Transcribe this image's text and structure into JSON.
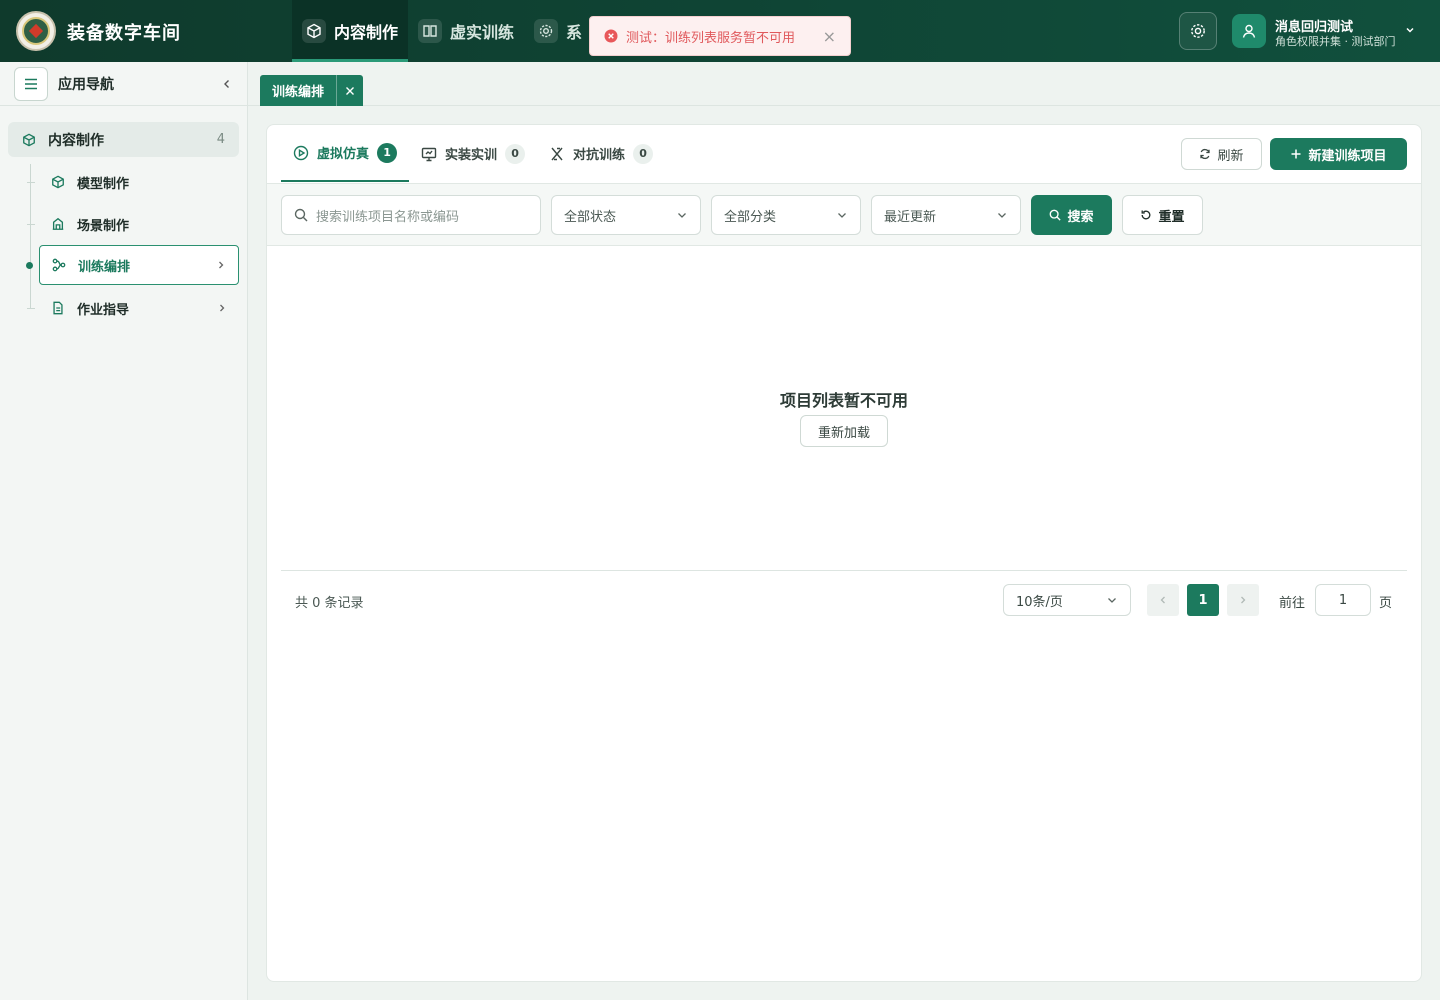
{
  "header": {
    "app_title": "装备数字车间",
    "nav": [
      {
        "label": "内容制作",
        "active": true,
        "icon": "cube-icon"
      },
      {
        "label": "虚实训练",
        "active": false,
        "icon": "book-icon"
      },
      {
        "label": "系",
        "active": false,
        "icon": "gear-icon"
      }
    ],
    "user": {
      "name": "消息回归测试",
      "role": "角色权限并集 · 测试部门"
    }
  },
  "toast": {
    "message": "测试：训练列表服务暂不可用",
    "type": "error"
  },
  "sidebar": {
    "title": "应用导航",
    "group": {
      "label": "内容制作",
      "count": "4"
    },
    "items": [
      {
        "label": "模型制作",
        "icon": "cube-icon"
      },
      {
        "label": "场景制作",
        "icon": "building-icon"
      },
      {
        "label": "训练编排",
        "icon": "flow-icon",
        "active": true
      },
      {
        "label": "作业指导",
        "icon": "document-icon"
      }
    ]
  },
  "page_tab": {
    "label": "训练编排"
  },
  "content_tabs": [
    {
      "label": "虚拟仿真",
      "count": "1",
      "active": true
    },
    {
      "label": "实装实训",
      "count": "0"
    },
    {
      "label": "对抗训练",
      "count": "0"
    }
  ],
  "actions": {
    "refresh": "刷新",
    "new": "新建训练项目"
  },
  "filters": {
    "search_placeholder": "搜索训练项目名称或编码",
    "status": "全部状态",
    "category": "全部分类",
    "sort": "最近更新",
    "search_btn": "搜索",
    "reset_btn": "重置"
  },
  "empty": {
    "title": "项目列表暂不可用",
    "reload": "重新加载"
  },
  "pagination": {
    "total": "共 0 条记录",
    "page_size": "10条/页",
    "current": "1",
    "goto_label": "前往",
    "goto_value": "1",
    "page_unit": "页"
  },
  "colors": {
    "primary": "#1c7a5e",
    "header": "#0f4535",
    "error": "#e0595c"
  }
}
